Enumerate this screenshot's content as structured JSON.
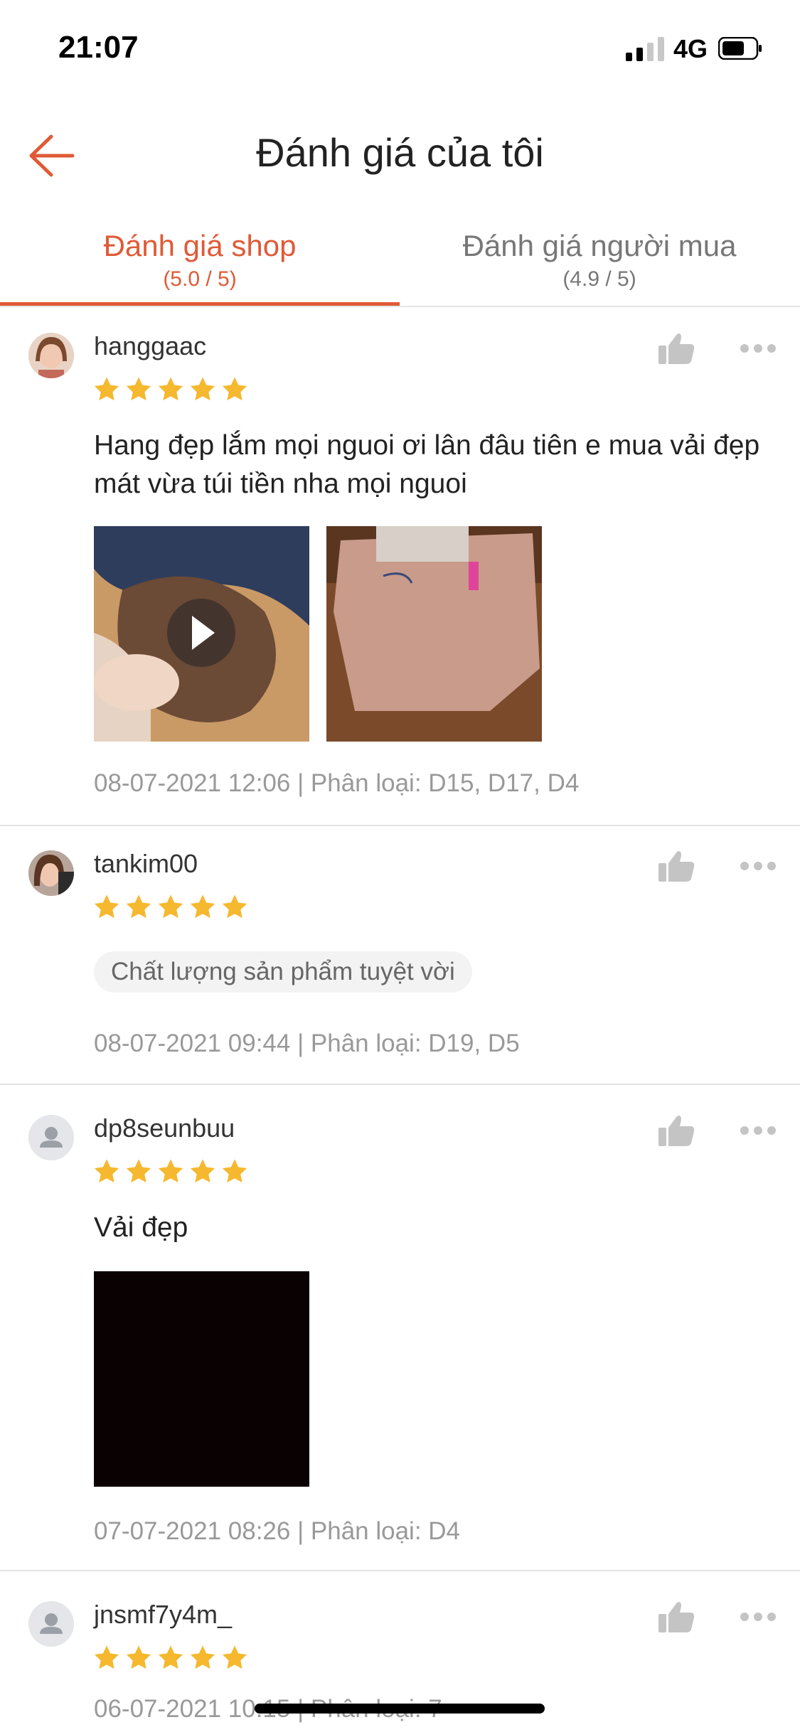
{
  "status_bar": {
    "time": "21:07",
    "network": "4G"
  },
  "header": {
    "title": "Đánh giá của tôi"
  },
  "tabs": [
    {
      "label": "Đánh giá shop",
      "sub": "(5.0 / 5)",
      "active": true
    },
    {
      "label": "Đánh giá người mua",
      "sub": "(4.9 / 5)",
      "active": false
    }
  ],
  "colors": {
    "accent": "#e05a35",
    "star": "#f5b82e",
    "meta": "#999999"
  },
  "reviews": [
    {
      "username": "hanggaac",
      "rating": 5,
      "text": "Hang đẹp lắm mọi nguoi ơi lân đâu tiên e mua vải đẹp mát vừa túi tiền nha mọi nguoi",
      "meta": "08-07-2021 12:06 | Phân loại: D15, D17, D4"
    },
    {
      "username": "tankim00",
      "rating": 5,
      "tag": "Chất lượng sản phẩm tuyệt vời",
      "meta": "08-07-2021 09:44 | Phân loại: D19, D5"
    },
    {
      "username": "dp8seunbuu",
      "rating": 5,
      "text": "Vải đẹp",
      "meta": "07-07-2021 08:26 | Phân loại: D4"
    },
    {
      "username": "jnsmf7y4m_",
      "rating": 5,
      "meta": "06-07-2021 10:15 | Phân loại: 7"
    }
  ]
}
